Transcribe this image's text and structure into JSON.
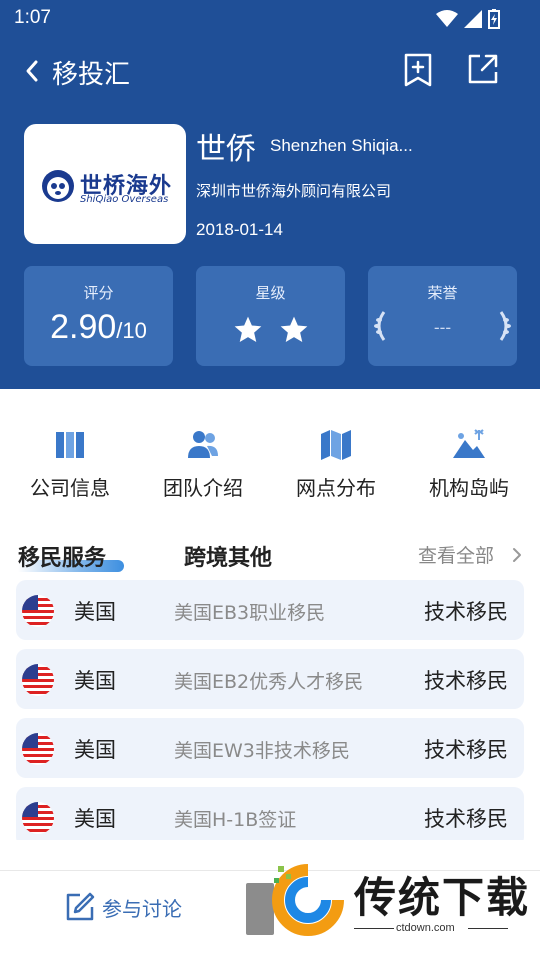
{
  "status_bar": {
    "time": "1:07"
  },
  "nav": {
    "title": "移投汇"
  },
  "org": {
    "logo_cn": "世桥海外",
    "logo_en": "ShiQiao Overseas",
    "name": "世侨",
    "name_en": "Shenzhen Shiqia...",
    "full_name": "深圳市世侨海外顾问有限公司",
    "date": "2018-01-14"
  },
  "stats": {
    "score_label": "评分",
    "score_value": "2.90",
    "score_max": "/10",
    "star_label": "星级",
    "star_count": 2,
    "honor_label": "荣誉",
    "honor_value": "---"
  },
  "quick_nav": [
    {
      "label": "公司信息",
      "icon": "book-icon"
    },
    {
      "label": "团队介绍",
      "icon": "team-icon"
    },
    {
      "label": "网点分布",
      "icon": "map-icon"
    },
    {
      "label": "机构岛屿",
      "icon": "island-icon"
    }
  ],
  "tabs": {
    "active": "移民服务",
    "other": "跨境其他",
    "view_all": "查看全部"
  },
  "services": [
    {
      "country": "美国",
      "program": "美国EB3职业移民",
      "type": "技术移民"
    },
    {
      "country": "美国",
      "program": "美国EB2优秀人才移民",
      "type": "技术移民"
    },
    {
      "country": "美国",
      "program": "美国EW3非技术移民",
      "type": "技术移民"
    },
    {
      "country": "美国",
      "program": "美国H-1B签证",
      "type": "技术移民"
    }
  ],
  "bottom": {
    "discuss_label": "参与讨论"
  },
  "watermark": {
    "text": "传统下载",
    "url": "ctdown.com"
  },
  "colors": {
    "header_bg": "#1f4f97",
    "card_bg": "#3a6db4",
    "row_bg": "#eef3fb",
    "accent": "#3d8fe0"
  }
}
